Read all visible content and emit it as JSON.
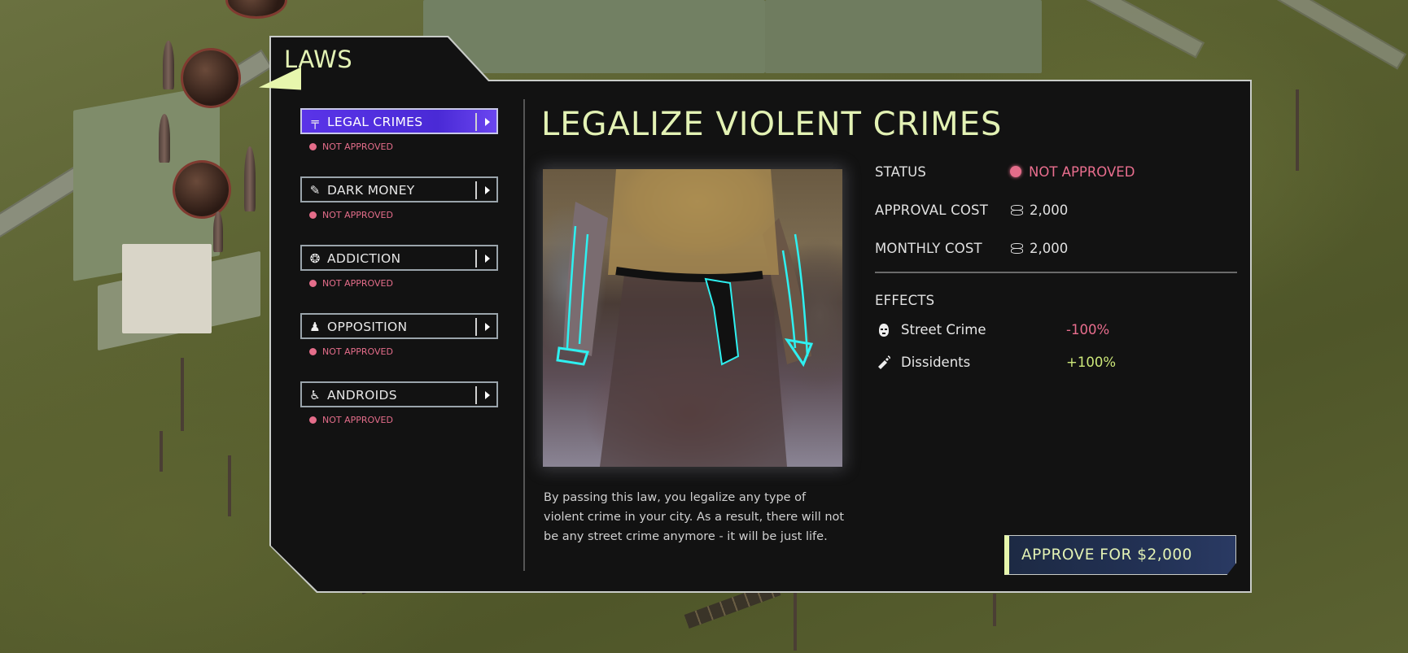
{
  "panel": {
    "title": "LAWS"
  },
  "laws": [
    {
      "label": "LEGAL CRIMES",
      "status": "NOT APPROVED",
      "icon": "gun-icon",
      "glyph": "╤",
      "active": true
    },
    {
      "label": "DARK MONEY",
      "status": "NOT APPROVED",
      "icon": "money-icon",
      "glyph": "✎"
    },
    {
      "label": "ADDICTION",
      "status": "NOT APPROVED",
      "icon": "addiction-icon",
      "glyph": "❂"
    },
    {
      "label": "OPPOSITION",
      "status": "NOT APPROVED",
      "icon": "opposition-icon",
      "glyph": "♟"
    },
    {
      "label": "ANDROIDS",
      "status": "NOT APPROVED",
      "icon": "android-icon",
      "glyph": "♿"
    }
  ],
  "detail": {
    "title": "LEGALIZE VIOLENT CRIMES",
    "status_label": "STATUS",
    "status_value": "NOT APPROVED",
    "approval_cost_label": "APPROVAL COST",
    "approval_cost_value": "2,000",
    "monthly_cost_label": "MONTHLY COST",
    "monthly_cost_value": "2,000",
    "effects_label": "EFFECTS",
    "effects": [
      {
        "label": "Street Crime",
        "value": "-100%",
        "icon": "mask-icon",
        "color": "#e96e8e"
      },
      {
        "label": "Dissidents",
        "value": "+100%",
        "icon": "molotov-icon",
        "color": "#cde87a"
      }
    ],
    "description": "By passing this law, you legalize any type of violent crime in your city. As a result, there will not be any street crime anymore - it will be just life.",
    "approve_button": "APPROVE FOR $2,000"
  },
  "colors": {
    "accent": "#e3f2b4",
    "active_tab": "#5a34e8",
    "warning": "#e46d8a",
    "positive": "#cde87a"
  }
}
